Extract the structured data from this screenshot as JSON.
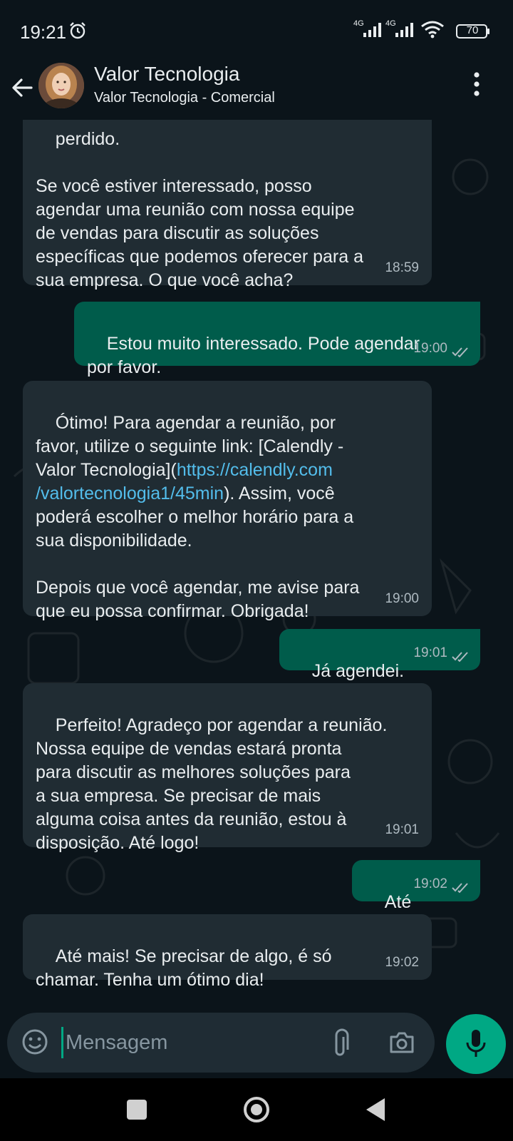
{
  "status_bar": {
    "time": "19:21",
    "signal1_label": "4G",
    "signal2_label": "4G",
    "battery": "70"
  },
  "header": {
    "contact_name": "Valor Tecnologia",
    "contact_subtitle": "Valor Tecnologia - Comercial"
  },
  "messages": [
    {
      "direction": "in",
      "text": "perdido.\n\nSe você estiver interessado, posso\nagendar uma reunião com nossa equipe\nde vendas para discutir as soluções\nespecíficas que podemos oferecer para a\nsua empresa. O que você acha?",
      "time": "18:59"
    },
    {
      "direction": "out",
      "text": "Estou muito interessado. Pode agendar\npor favor.",
      "time": "19:00"
    },
    {
      "direction": "in",
      "text_before_link": "Ótimo! Para agendar a reunião, por\nfavor, utilize o seguinte link: [Calendly -\nValor Tecnologia](",
      "link": "https://calendly.com\n/valortecnologia1/45min",
      "text_after_link": "). Assim, você\npoderá escolher o melhor horário para a\nsua disponibilidade.\n\nDepois que você agendar, me avise para\nque eu possa confirmar. Obrigada!",
      "time": "19:00"
    },
    {
      "direction": "out",
      "text": "Já agendei.",
      "time": "19:01"
    },
    {
      "direction": "in",
      "text": "Perfeito! Agradeço por agendar a reunião.\nNossa equipe de vendas estará pronta\npara discutir as melhores soluções para\na sua empresa. Se precisar de mais\nalguma coisa antes da reunião, estou à\ndisposição. Até logo!",
      "time": "19:01"
    },
    {
      "direction": "out",
      "text": "Até",
      "time": "19:02"
    },
    {
      "direction": "in",
      "text": "Até mais! Se precisar de algo, é só\nchamar. Tenha um ótimo dia!",
      "time": "19:02"
    }
  ],
  "composer": {
    "placeholder": "Mensagem",
    "value": ""
  },
  "colors": {
    "background": "#0b141a",
    "incoming_bubble": "#202c33",
    "outgoing_bubble": "#005c4b",
    "accent": "#00a884",
    "link": "#53bdeb"
  },
  "icons": [
    "alarm-icon",
    "signal-icon",
    "wifi-icon",
    "battery-icon",
    "back-arrow-icon",
    "more-vertical-icon",
    "double-check-icon",
    "emoji-icon",
    "paperclip-icon",
    "camera-icon",
    "microphone-icon",
    "recent-apps-icon",
    "home-icon",
    "back-triangle-icon"
  ]
}
